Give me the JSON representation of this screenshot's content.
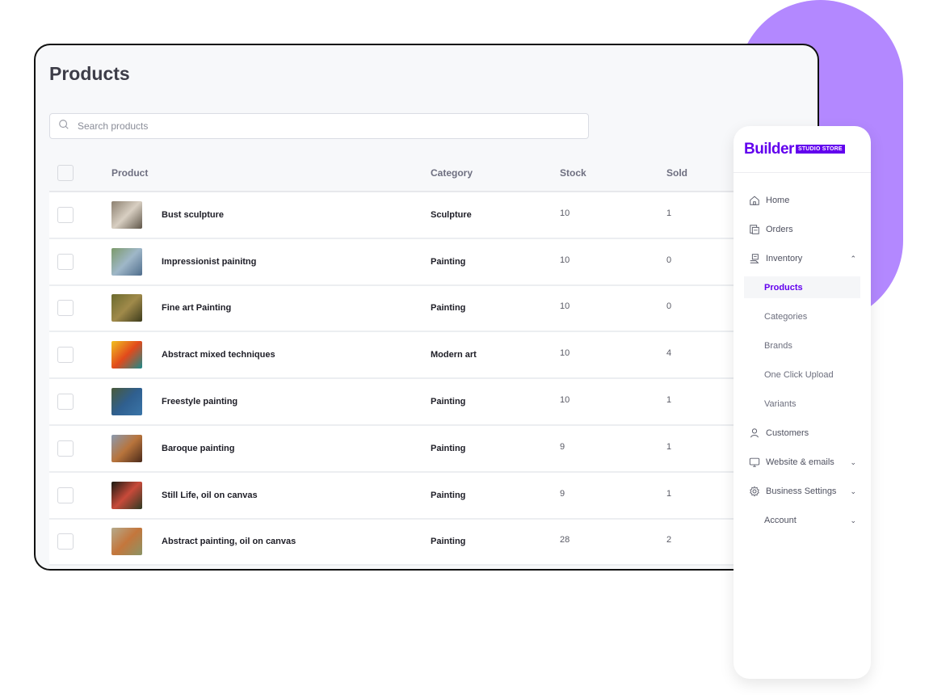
{
  "page": {
    "title": "Products",
    "search": {
      "placeholder": "Search products",
      "value": ""
    }
  },
  "table": {
    "columns": [
      "Product",
      "Category",
      "Stock",
      "Sold"
    ],
    "rows": [
      {
        "name": "Bust sculpture",
        "category": "Sculpture",
        "stock": "10",
        "sold": "1",
        "thumb_colors": [
          "#8c8070",
          "#d8cfc2",
          "#5e5548"
        ]
      },
      {
        "name": "Impressionist painitng",
        "category": "Painting",
        "stock": "10",
        "sold": "0",
        "thumb_colors": [
          "#7c9a6a",
          "#9fb7c8",
          "#4f6d8c"
        ]
      },
      {
        "name": "Fine art Painting",
        "category": "Painting",
        "stock": "10",
        "sold": "0",
        "thumb_colors": [
          "#6b6a2e",
          "#a08a4a",
          "#3d3c1c"
        ]
      },
      {
        "name": "Abstract mixed techniques",
        "category": "Modern art",
        "stock": "10",
        "sold": "4",
        "thumb_colors": [
          "#f0c020",
          "#e24a1c",
          "#1a8a8a"
        ]
      },
      {
        "name": "Freestyle painting",
        "category": "Painting",
        "stock": "10",
        "sold": "1",
        "thumb_colors": [
          "#4a5a3a",
          "#2f5f8f",
          "#3a75a8"
        ]
      },
      {
        "name": "Baroque painting",
        "category": "Painting",
        "stock": "9",
        "sold": "1",
        "thumb_colors": [
          "#8a9ab0",
          "#b8743c",
          "#4a2a1a"
        ]
      },
      {
        "name": "Still Life, oil on canvas",
        "category": "Painting",
        "stock": "9",
        "sold": "1",
        "thumb_colors": [
          "#1a1a12",
          "#c84a3a",
          "#2e3a22"
        ]
      },
      {
        "name": "Abstract painting, oil on canvas",
        "category": "Painting",
        "stock": "28",
        "sold": "2",
        "thumb_colors": [
          "#b4aa8c",
          "#c4763c",
          "#8a9466"
        ]
      }
    ]
  },
  "sidebar": {
    "brand": {
      "word": "Builder",
      "badge": "STUDIO STORE"
    },
    "items": [
      {
        "label": "Home",
        "icon": "home-icon"
      },
      {
        "label": "Orders",
        "icon": "orders-icon"
      },
      {
        "label": "Inventory",
        "icon": "inventory-icon",
        "chevron": "^"
      },
      {
        "label": "Products",
        "active": true
      },
      {
        "label": "Categories"
      },
      {
        "label": "Brands"
      },
      {
        "label": "One Click Upload"
      },
      {
        "label": "Variants"
      },
      {
        "label": "Customers",
        "icon": "customers-icon"
      },
      {
        "label": "Website & emails",
        "icon": "monitor-icon",
        "chevron": "v"
      },
      {
        "label": "Business Settings",
        "icon": "gear-icon",
        "chevron": "v"
      },
      {
        "label": "Account",
        "chevron": "v"
      }
    ]
  },
  "colors": {
    "accent": "#6200ee",
    "blob": "#b388ff",
    "window_bg": "#f7f8fa"
  }
}
